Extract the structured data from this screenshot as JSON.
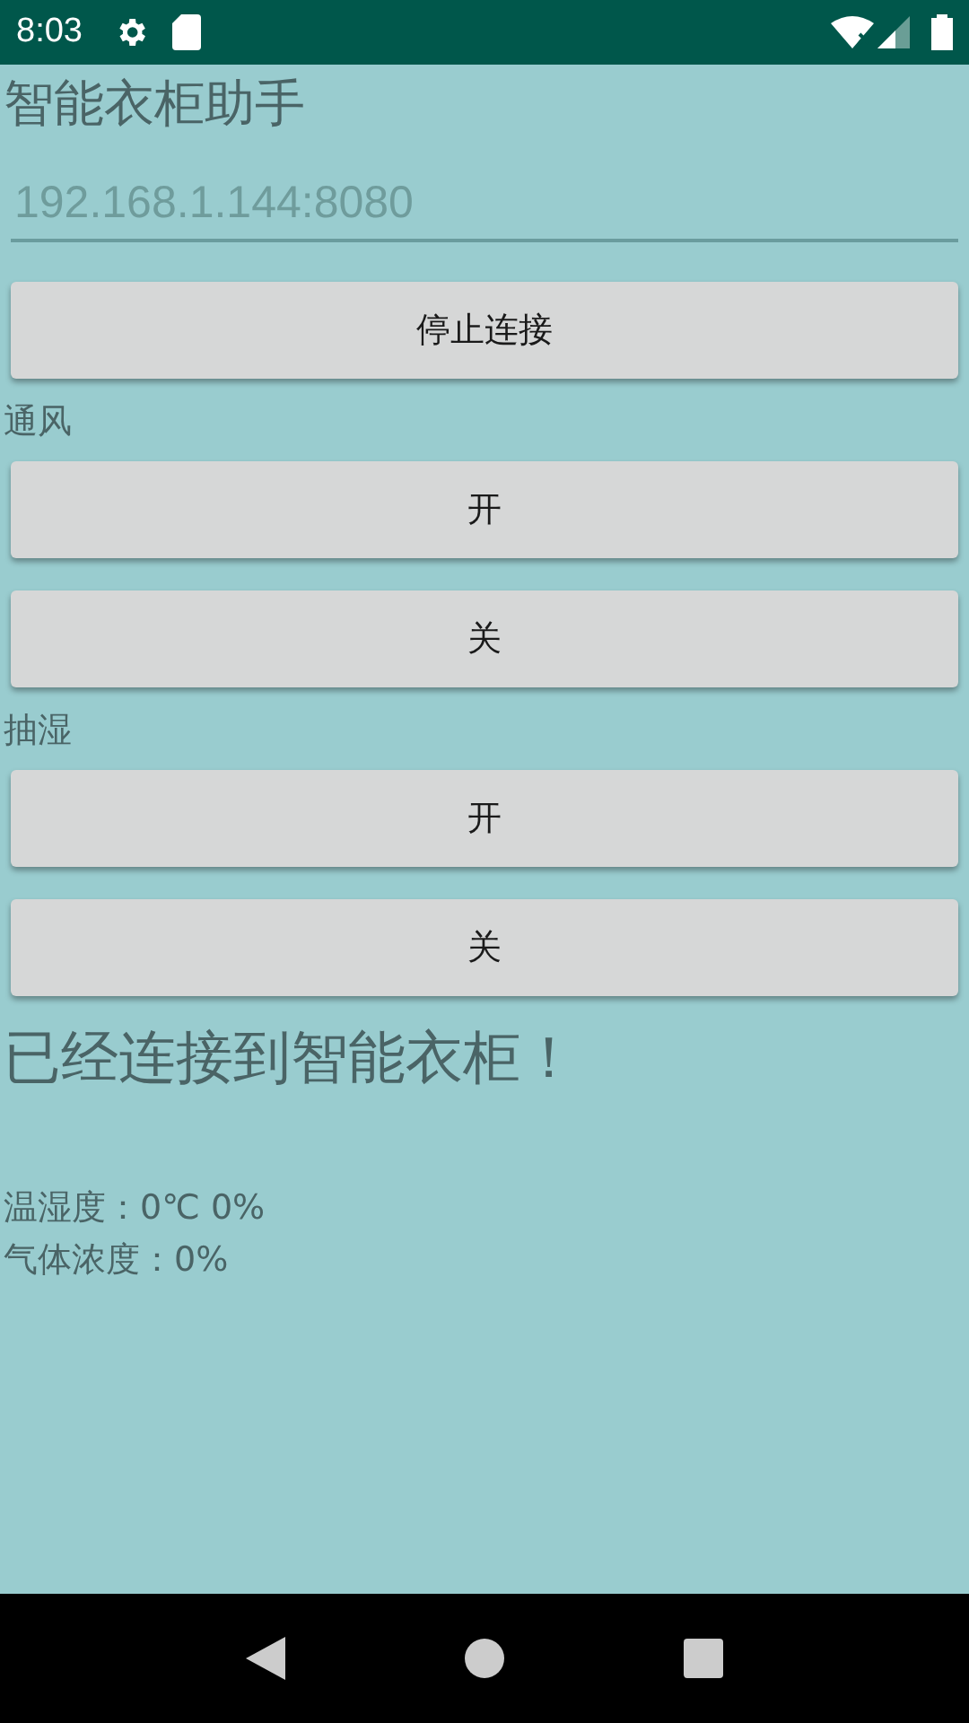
{
  "status_bar": {
    "time": "8:03"
  },
  "title": "智能衣柜助手",
  "address_field": {
    "placeholder": "192.168.1.144:8080"
  },
  "connect_button": "停止连接",
  "controls": [
    {
      "label": "通风",
      "buttons": [
        "开",
        "关"
      ]
    },
    {
      "label": "抽湿",
      "buttons": [
        "开",
        "关"
      ]
    }
  ],
  "connection_status": "已经连接到智能衣柜！",
  "readings": [
    "温湿度：0℃ 0%",
    "气体浓度：0%"
  ]
}
